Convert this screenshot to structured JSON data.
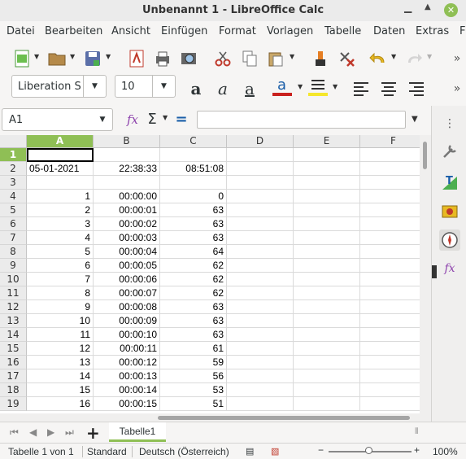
{
  "window": {
    "title": "Unbenannt 1 - LibreOffice Calc"
  },
  "menu": [
    "Datei",
    "Bearbeiten",
    "Ansicht",
    "Einfügen",
    "Format",
    "Vorlagen",
    "Tabelle",
    "Daten",
    "Extras",
    "F"
  ],
  "format_bar": {
    "font_name": "Liberation S",
    "font_size": "10"
  },
  "formula_bar": {
    "name_box": "A1",
    "formula": ""
  },
  "columns": [
    "A",
    "B",
    "C",
    "D",
    "E",
    "F"
  ],
  "rows": [
    {
      "n": "1",
      "a": "",
      "b": "",
      "c": ""
    },
    {
      "n": "2",
      "a": "05-01-2021",
      "b": "22:38:33",
      "c": "08:51:08"
    },
    {
      "n": "3",
      "a": "",
      "b": "",
      "c": ""
    },
    {
      "n": "4",
      "a": "1",
      "b": "00:00:00",
      "c": "0"
    },
    {
      "n": "5",
      "a": "2",
      "b": "00:00:01",
      "c": "63"
    },
    {
      "n": "6",
      "a": "3",
      "b": "00:00:02",
      "c": "63"
    },
    {
      "n": "7",
      "a": "4",
      "b": "00:00:03",
      "c": "63"
    },
    {
      "n": "8",
      "a": "5",
      "b": "00:00:04",
      "c": "64"
    },
    {
      "n": "9",
      "a": "6",
      "b": "00:00:05",
      "c": "62"
    },
    {
      "n": "10",
      "a": "7",
      "b": "00:00:06",
      "c": "62"
    },
    {
      "n": "11",
      "a": "8",
      "b": "00:00:07",
      "c": "62"
    },
    {
      "n": "12",
      "a": "9",
      "b": "00:00:08",
      "c": "63"
    },
    {
      "n": "13",
      "a": "10",
      "b": "00:00:09",
      "c": "63"
    },
    {
      "n": "14",
      "a": "11",
      "b": "00:00:10",
      "c": "63"
    },
    {
      "n": "15",
      "a": "12",
      "b": "00:00:11",
      "c": "61"
    },
    {
      "n": "16",
      "a": "13",
      "b": "00:00:12",
      "c": "59"
    },
    {
      "n": "17",
      "a": "14",
      "b": "00:00:13",
      "c": "56"
    },
    {
      "n": "18",
      "a": "15",
      "b": "00:00:14",
      "c": "53"
    },
    {
      "n": "19",
      "a": "16",
      "b": "00:00:15",
      "c": "51"
    }
  ],
  "sheet_tab": "Tabelle1",
  "status": {
    "sheet": "Tabelle 1 von 1",
    "style": "Standard",
    "language": "Deutsch (Österreich)",
    "zoom_level": "100%"
  },
  "colors": {
    "accent": "#8fbf55"
  }
}
